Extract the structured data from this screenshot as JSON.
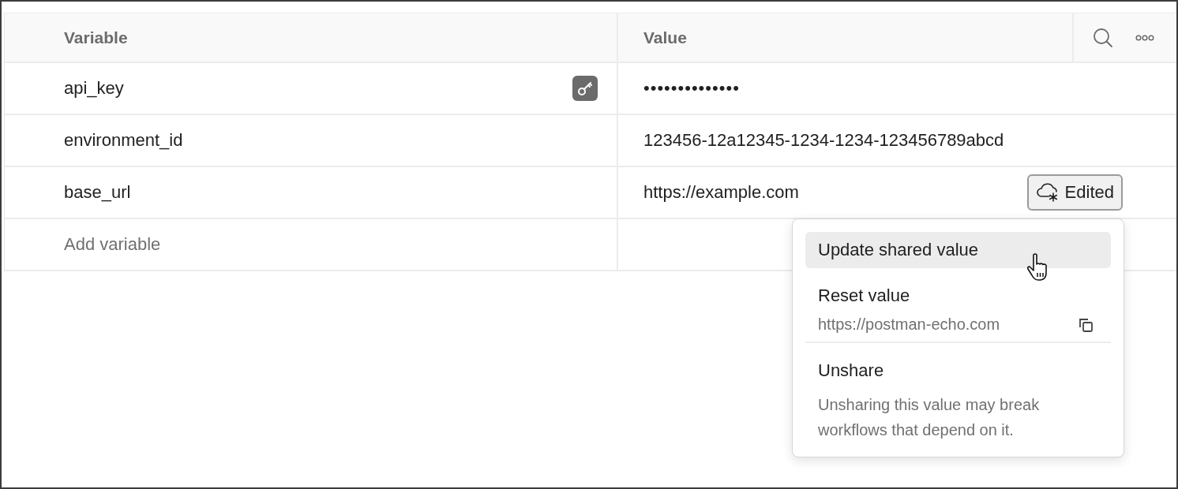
{
  "table": {
    "columns": [
      "Variable",
      "Value"
    ],
    "rows": [
      {
        "variable": "api_key",
        "value": "••••••••••••••",
        "secret": true
      },
      {
        "variable": "environment_id",
        "value": "123456-12a12345-1234-1234-123456789abcd",
        "secret": false
      },
      {
        "variable": "base_url",
        "value": "https://example.com",
        "secret": false,
        "badge": "Edited"
      }
    ],
    "add_row": {
      "placeholder": "Add variable"
    }
  },
  "menu": {
    "sections": [
      {
        "items": [
          {
            "label": "Update shared value",
            "selected": true
          },
          {
            "label": "Reset value",
            "selected": false,
            "detail": "https://postman-echo.com"
          }
        ]
      },
      {
        "items": [
          {
            "label": "Unshare",
            "selected": false,
            "description": "Unsharing this value may break workflows that depend on it."
          }
        ]
      }
    ]
  }
}
